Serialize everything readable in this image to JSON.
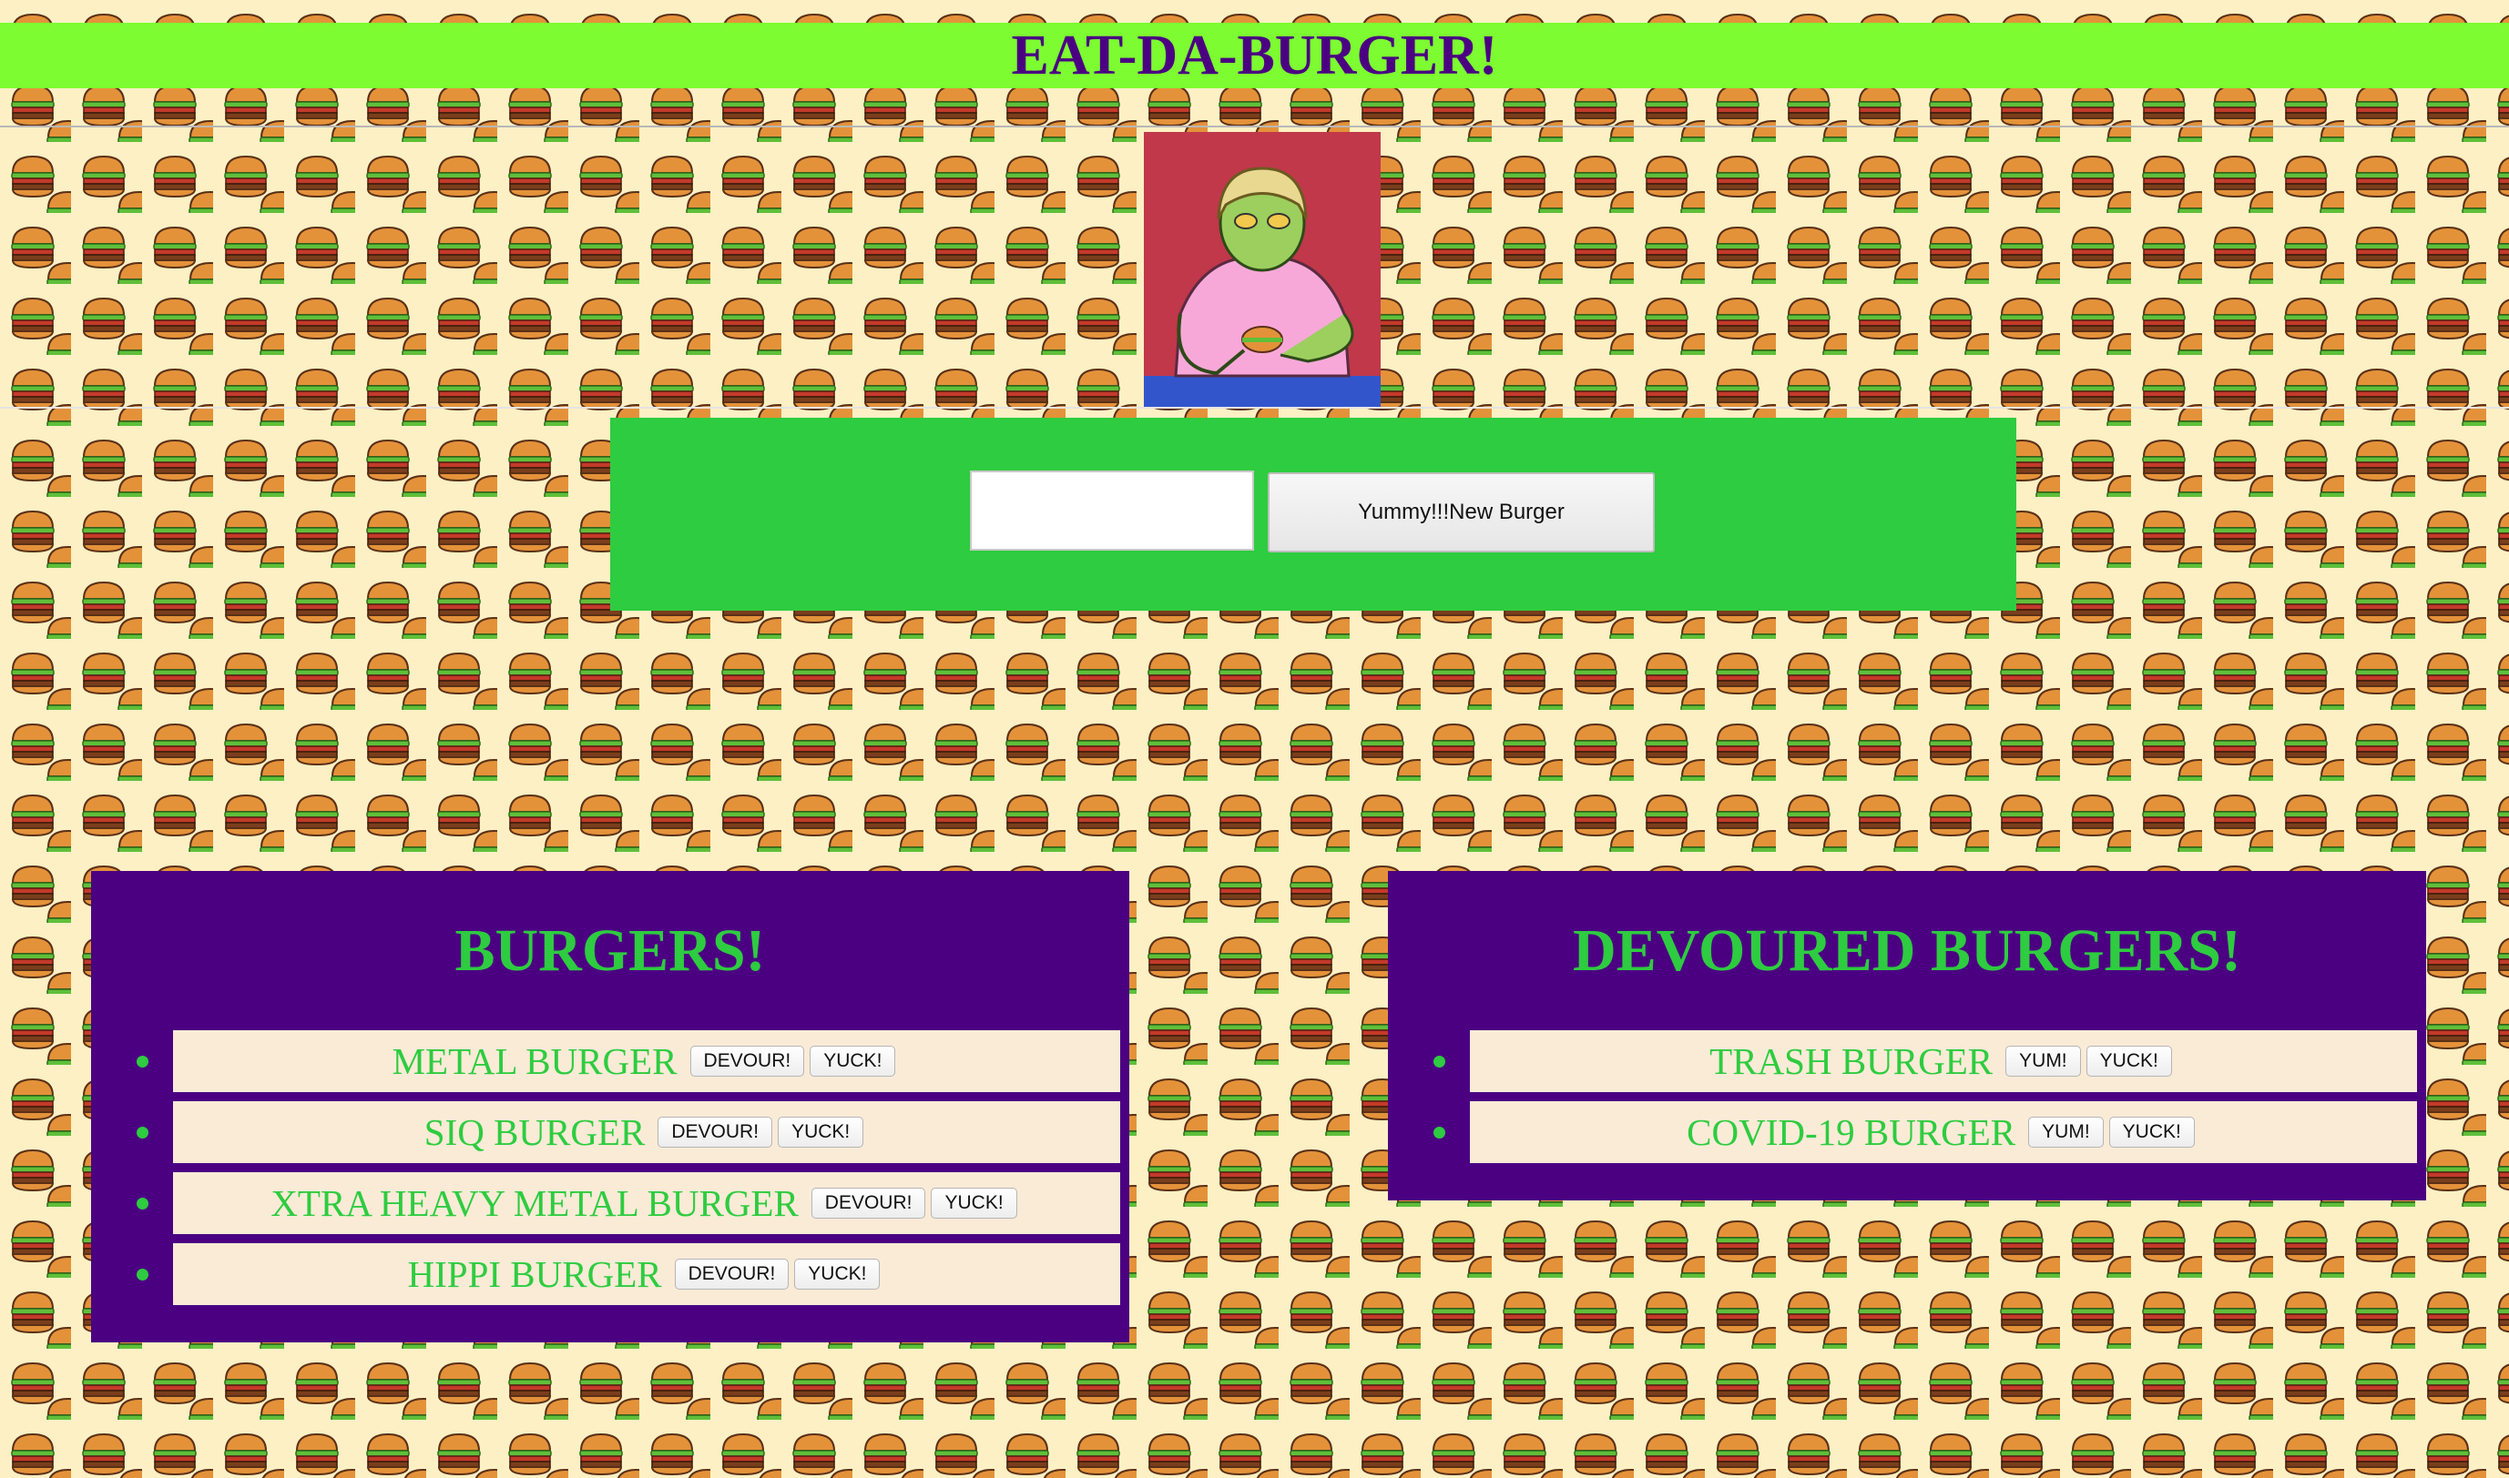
{
  "header": {
    "title": "EAT-DA-BURGER!"
  },
  "colors": {
    "background": "#fdf0c4",
    "header_bar": "#7cfc31",
    "title_text": "#4b0082",
    "panel": "#4b0082",
    "accent_green": "#2ecc40",
    "list_item": "#faebd7"
  },
  "mascot": {
    "icon": "burger-eater-illustration"
  },
  "form": {
    "input_value": "",
    "submit_label": "Yummy!!!New Burger"
  },
  "burgers_list": {
    "heading": "BURGERS!",
    "items": [
      {
        "name": "METAL BURGER",
        "action1": "DEVOUR!",
        "action2": "YUCK!"
      },
      {
        "name": "SIQ BURGER",
        "action1": "DEVOUR!",
        "action2": "YUCK!"
      },
      {
        "name": "XTRA HEAVY METAL BURGER",
        "action1": "DEVOUR!",
        "action2": "YUCK!"
      },
      {
        "name": "HIPPI BURGER",
        "action1": "DEVOUR!",
        "action2": "YUCK!"
      }
    ]
  },
  "devoured_list": {
    "heading": "DEVOURED BURGERS!",
    "items": [
      {
        "name": "TRASH BURGER",
        "action1": "YUM!",
        "action2": "YUCK!"
      },
      {
        "name": "COVID-19 BURGER",
        "action1": "YUM!",
        "action2": "YUCK!"
      }
    ]
  }
}
